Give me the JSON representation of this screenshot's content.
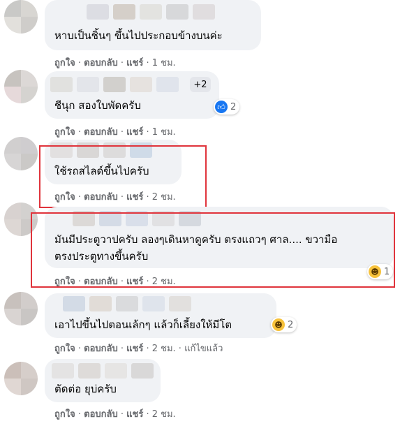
{
  "comments": [
    {
      "text_lines": [
        "หาบเป็นชิ้นๆ ขึ้นไปประกอบข้างบนค่ะ"
      ],
      "actions": {
        "like": "ถูกใจ",
        "reply": "ตอบกลับ",
        "share": "แชร์",
        "time": "1 ชม.",
        "edited": ""
      }
    },
    {
      "text_lines": [
        "ชีนุก สองใบพัดครับ"
      ],
      "more_tag": "+2",
      "reaction": {
        "type": "like-icon",
        "count": "2"
      },
      "actions": {
        "like": "ถูกใจ",
        "reply": "ตอบกลับ",
        "share": "แชร์",
        "time": "1 ชม.",
        "edited": ""
      }
    },
    {
      "text_lines": [
        "ใช้รถสไลด์ขึ้นไปครับ"
      ],
      "actions": {
        "like": "ถูกใจ",
        "reply": "ตอบกลับ",
        "share": "แชร์",
        "time": "2 ชม.",
        "edited": ""
      }
    },
    {
      "text_lines": [
        "มันมีประตูวาปครับ ลองๆเดินหาดูครับ ตรงแถวๆ ศาล.... ขวามือ",
        "ตรงประตูทางขึ้นครับ"
      ],
      "reaction": {
        "type": "haha-icon",
        "count": "1"
      },
      "actions": {
        "like": "ถูกใจ",
        "reply": "ตอบกลับ",
        "share": "แชร์",
        "time": "2 ชม.",
        "edited": ""
      }
    },
    {
      "text_lines": [
        "เอาไปขึ้นไปตอนเล้กๆ แล้วก็เลี้ยงให้มีโต"
      ],
      "reaction": {
        "type": "haha-icon",
        "count": "2"
      },
      "actions": {
        "like": "ถูกใจ",
        "reply": "ตอบกลับ",
        "share": "แชร์",
        "time": "2 ชม.",
        "edited": "แก้ไขแล้ว"
      }
    },
    {
      "text_lines": [
        "ตัดต่อ ยุบ่ครับ"
      ],
      "actions": {
        "like": "ถูกใจ",
        "reply": "ตอบกลับ",
        "share": "แชร์",
        "time": "2 ชม.",
        "edited": ""
      }
    }
  ],
  "colors": {
    "highlight": "#e0343c",
    "bubble": "#f0f2f5",
    "meta": "#65676b",
    "like_blue": "#1877f2",
    "haha_yellow": "#f7c23b"
  }
}
